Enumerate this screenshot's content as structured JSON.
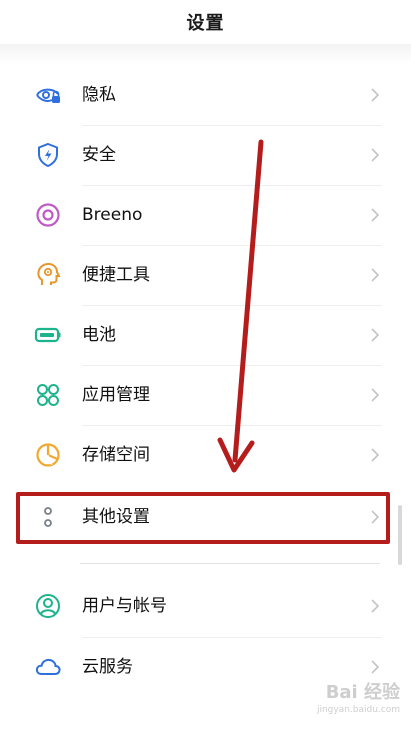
{
  "header": {
    "title": "设置"
  },
  "settings": {
    "items": [
      {
        "label": "隐私",
        "icon": "privacy-eye-icon"
      },
      {
        "label": "安全",
        "icon": "security-shield-icon"
      },
      {
        "label": "Breeno",
        "icon": "breeno-ring-icon"
      },
      {
        "label": "便捷工具",
        "icon": "convenience-head-icon"
      },
      {
        "label": "电池",
        "icon": "battery-icon"
      },
      {
        "label": "应用管理",
        "icon": "app-grid-icon"
      },
      {
        "label": "存储空间",
        "icon": "storage-pie-icon"
      },
      {
        "label": "其他设置",
        "icon": "more-dots-icon"
      },
      {
        "label": "用户与帐号",
        "icon": "user-account-icon"
      },
      {
        "label": "云服务",
        "icon": "cloud-icon"
      }
    ]
  },
  "watermark": {
    "logo": "Bai 经验",
    "url": "jingyan.baidu.com"
  },
  "colors": {
    "accent": "#2f6fde",
    "annotation": "#b51d1d"
  }
}
